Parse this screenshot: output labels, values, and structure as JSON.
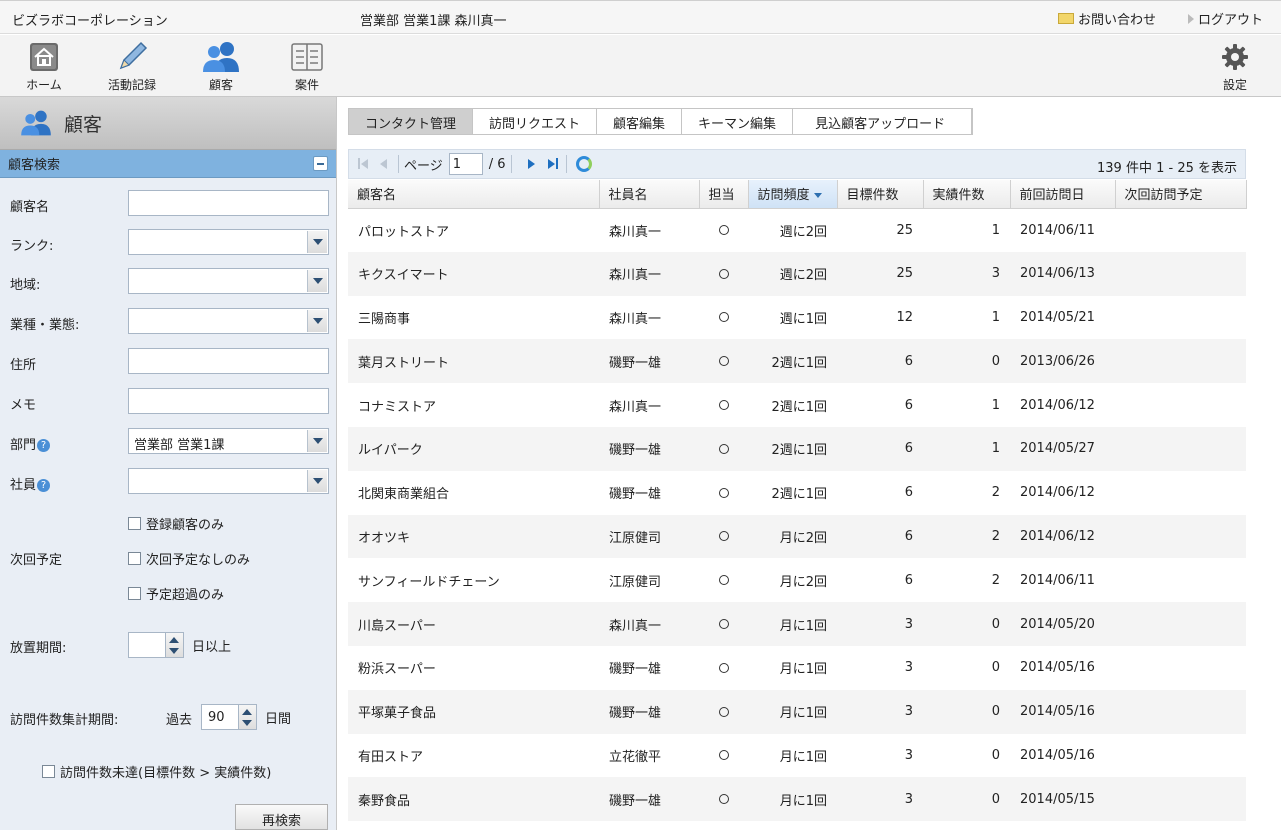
{
  "topbar": {
    "company": "ビズラボコーポレーション",
    "user": "営業部  営業1課 森川真一",
    "contact_label": "お問い合わせ",
    "logout_label": "ログアウト"
  },
  "toolbar": {
    "home": "ホーム",
    "activity": "活動記録",
    "customer": "顧客",
    "deal": "案件",
    "settings": "設定"
  },
  "sidebar": {
    "title": "顧客",
    "search_header": "顧客検索",
    "fields": {
      "name": "顧客名",
      "rank": "ランク:",
      "region": "地域:",
      "industry": "業種・業態:",
      "address": "住所",
      "memo": "メモ",
      "department": "部門",
      "department_value": "営業部  営業1課",
      "employee": "社員"
    },
    "checkboxes": {
      "registered_only": "登録顧客のみ",
      "next_label": "次回予定",
      "no_next_only": "次回予定なしのみ",
      "overdue_only": "予定超過のみ"
    },
    "neglect": {
      "label": "放置期間:",
      "value": "",
      "suffix": "日以上"
    },
    "visit_period": {
      "label": "訪問件数集計期間:",
      "prefix": "過去",
      "value": "90",
      "suffix": "日間"
    },
    "unmet_label": "訪問件数未達(目標件数 > 実績件数)",
    "research_button": "再検索"
  },
  "tabs": [
    "コンタクト管理",
    "訪問リクエスト",
    "顧客編集",
    "キーマン編集",
    "見込顧客アップロード"
  ],
  "pager": {
    "page_label": "ページ",
    "page_value": "1",
    "total_pages": "/ 6",
    "summary": "139 件中 1 - 25 を表示"
  },
  "table": {
    "headers": [
      "顧客名",
      "社員名",
      "担当",
      "訪問頻度",
      "目標件数",
      "実績件数",
      "前回訪問日",
      "次回訪問予定"
    ],
    "rows": [
      [
        "パロットストア",
        "森川真一",
        "○",
        "週に2回",
        "25",
        "1",
        "2014/06/11",
        ""
      ],
      [
        "キクスイマート",
        "森川真一",
        "○",
        "週に2回",
        "25",
        "3",
        "2014/06/13",
        ""
      ],
      [
        "三陽商事",
        "森川真一",
        "○",
        "週に1回",
        "12",
        "1",
        "2014/05/21",
        ""
      ],
      [
        "葉月ストリート",
        "磯野一雄",
        "○",
        "2週に1回",
        "6",
        "0",
        "2013/06/26",
        ""
      ],
      [
        "コナミストア",
        "森川真一",
        "○",
        "2週に1回",
        "6",
        "1",
        "2014/06/12",
        ""
      ],
      [
        "ルイパーク",
        "磯野一雄",
        "○",
        "2週に1回",
        "6",
        "1",
        "2014/05/27",
        ""
      ],
      [
        "北関東商業組合",
        "磯野一雄",
        "○",
        "2週に1回",
        "6",
        "2",
        "2014/06/12",
        ""
      ],
      [
        "オオツキ",
        "江原健司",
        "○",
        "月に2回",
        "6",
        "2",
        "2014/06/12",
        ""
      ],
      [
        "サンフィールドチェーン",
        "江原健司",
        "○",
        "月に2回",
        "6",
        "2",
        "2014/06/11",
        ""
      ],
      [
        "川島スーパー",
        "森川真一",
        "○",
        "月に1回",
        "3",
        "0",
        "2014/05/20",
        ""
      ],
      [
        "粉浜スーパー",
        "磯野一雄",
        "○",
        "月に1回",
        "3",
        "0",
        "2014/05/16",
        ""
      ],
      [
        "平塚菓子食品",
        "磯野一雄",
        "○",
        "月に1回",
        "3",
        "0",
        "2014/05/16",
        ""
      ],
      [
        "有田ストア",
        "立花徹平",
        "○",
        "月に1回",
        "3",
        "0",
        "2014/05/16",
        ""
      ],
      [
        "秦野食品",
        "磯野一雄",
        "○",
        "月に1回",
        "3",
        "0",
        "2014/05/15",
        ""
      ]
    ]
  },
  "colors": {
    "search_header": "#7fb2df",
    "sidebar_bg": "#e9eef5",
    "link_blue": "#1e6fc0"
  }
}
